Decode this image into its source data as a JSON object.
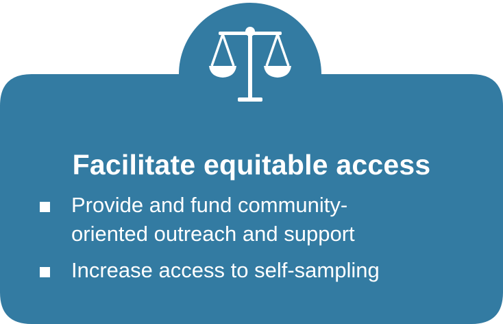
{
  "brand": {
    "panel_color": "#337ba2",
    "text_color": "#ffffff"
  },
  "icon": {
    "name": "scales-of-justice-icon"
  },
  "card": {
    "title": "Facilitate equitable access",
    "items": [
      {
        "line1": "Provide and fund  community-",
        "line2": "oriented outreach and support"
      },
      {
        "line1": "Increase access to self-sampling"
      }
    ]
  }
}
